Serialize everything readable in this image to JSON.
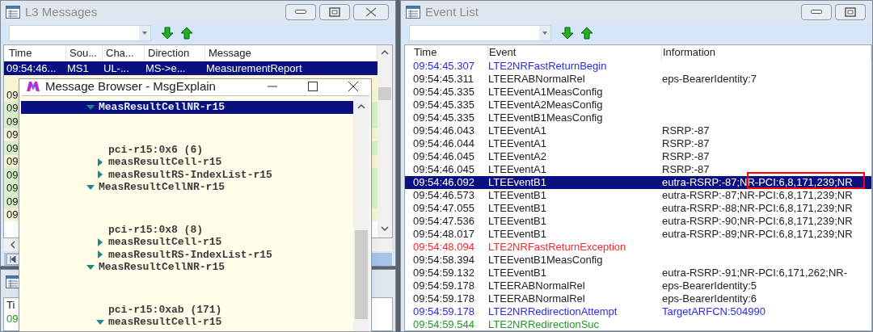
{
  "l3_messages": {
    "title": "L3 Messages",
    "columns": [
      "Time",
      "Sou...",
      "Cha...",
      "Direction",
      "Message"
    ],
    "rows": [
      {
        "cells": [
          "09:54:46...",
          "MS1",
          "UL-...",
          "MS->e...",
          "MeasurementReport"
        ],
        "selected": true
      },
      {
        "selected": false,
        "color": "#f7f5d4"
      },
      {
        "cells": [
          "09"
        ],
        "selected": false,
        "color": "#f7f5d4"
      },
      {
        "cells": [
          "09"
        ],
        "selected": false,
        "color": "#d9f0c9"
      },
      {
        "cells": [
          "09"
        ],
        "selected": false,
        "color": "#d9f0c9"
      },
      {
        "cells": [
          "09"
        ],
        "selected": false,
        "color": "#f7f5d4"
      },
      {
        "cells": [
          "09"
        ],
        "selected": false,
        "color": "#d9f0c9"
      },
      {
        "cells": [
          "09"
        ],
        "selected": false,
        "color": "#f7f5d4"
      },
      {
        "cells": [
          "09"
        ],
        "selected": false,
        "color": "#d9f0c9"
      },
      {
        "cells": [
          "09"
        ],
        "selected": false,
        "color": "#d9f0c9"
      },
      {
        "cells": [
          "09"
        ],
        "selected": false,
        "color": "#d9f0c9"
      },
      {
        "cells": [
          "09"
        ],
        "selected": false,
        "color": "#f7f5d4"
      }
    ]
  },
  "lower_window": {
    "columns": [
      "Ti"
    ],
    "rows": [
      {
        "cells": [
          "09"
        ],
        "color": "#229922"
      }
    ]
  },
  "message_browser": {
    "title": "Message Browser - MsgExplain",
    "tree": [
      {
        "label": "MeasResultCellNR-r15",
        "expanded": true,
        "selected": true,
        "children": [
          {
            "label": "pci-r15:0x6 (6)",
            "kind": "value"
          },
          {
            "label": "measResultCell-r15",
            "expanded": false,
            "selected": false
          },
          {
            "label": "measResultRS-IndexList-r15",
            "expanded": false,
            "selected": false
          }
        ]
      },
      {
        "label": "MeasResultCellNR-r15",
        "expanded": true,
        "selected": false,
        "children": [
          {
            "label": "pci-r15:0x8 (8)",
            "kind": "value"
          },
          {
            "label": "measResultCell-r15",
            "expanded": false,
            "selected": false
          },
          {
            "label": "measResultRS-IndexList-r15",
            "expanded": false,
            "selected": false
          }
        ]
      },
      {
        "label": "MeasResultCellNR-r15",
        "expanded": true,
        "selected": false,
        "children": [
          {
            "label": "pci-r15:0xab (171)",
            "kind": "value"
          },
          {
            "label": "measResultCell-r15",
            "expanded": true,
            "selected": false
          }
        ]
      }
    ]
  },
  "event_list": {
    "title": "Event List",
    "columns": [
      "Time",
      "Event",
      "Information"
    ],
    "rows": [
      {
        "time": "09:54:45.307",
        "event": "LTE2NRFastReturnBegin",
        "color": "#2a2ae6",
        "selected": false
      },
      {
        "time": "09:54:45.311",
        "event": "LTEERABNormalRel",
        "information": "eps-BearerIdentity:7",
        "color": "#202020",
        "selected": false
      },
      {
        "time": "09:54:45.335",
        "event": "LTEEventA1MeasConfig",
        "color": "#202020",
        "selected": false
      },
      {
        "time": "09:54:45.335",
        "event": "LTEEventA2MeasConfig",
        "color": "#202020",
        "selected": false
      },
      {
        "time": "09:54:45.335",
        "event": "LTEEventB1MeasConfig",
        "color": "#202020",
        "selected": false
      },
      {
        "time": "09:54:46.043",
        "event": "LTEEventA1",
        "information": "RSRP:-87",
        "color": "#202020",
        "selected": false
      },
      {
        "time": "09:54:46.044",
        "event": "LTEEventA1",
        "information": "RSRP:-87",
        "color": "#202020",
        "selected": false
      },
      {
        "time": "09:54:46.045",
        "event": "LTEEventA2",
        "information": "RSRP:-87",
        "color": "#202020",
        "selected": false
      },
      {
        "time": "09:54:46.045",
        "event": "LTEEventA1",
        "information": "RSRP:-87",
        "color": "#202020",
        "selected": false
      },
      {
        "time": "09:54:46.092",
        "event": "LTEEventB1",
        "information": "eutra-RSRP:-87;NR-PCI:6,8,171,239;NR",
        "selected": true,
        "annotated": true
      },
      {
        "time": "09:54:46.573",
        "event": "LTEEventB1",
        "information": "eutra-RSRP:-87;NR-PCI:6,8,171,239;NR",
        "color": "#202020",
        "selected": false
      },
      {
        "time": "09:54:47.055",
        "event": "LTEEventB1",
        "information": "eutra-RSRP:-88;NR-PCI:6,8,171,239;NR",
        "color": "#202020",
        "selected": false
      },
      {
        "time": "09:54:47.536",
        "event": "LTEEventB1",
        "information": "eutra-RSRP:-90;NR-PCI:6,8,171,239;NR",
        "color": "#202020",
        "selected": false
      },
      {
        "time": "09:54:48.017",
        "event": "LTEEventB1",
        "information": "eutra-RSRP:-89;NR-PCI:6,8,171,239;NR",
        "color": "#202020",
        "selected": false
      },
      {
        "time": "09:54:48.094",
        "event": "LTE2NRFastReturnException",
        "color": "#f52a2a",
        "selected": false
      },
      {
        "time": "09:54:58.394",
        "event": "LTEEventB1MeasConfig",
        "color": "#202020",
        "selected": false
      },
      {
        "time": "09:54:59.132",
        "event": "LTEEventB1",
        "information": "eutra-RSRP:-91;NR-PCI:6,171,262;NR-",
        "color": "#202020",
        "selected": false
      },
      {
        "time": "09:54:59.178",
        "event": "LTEERABNormalRel",
        "information": "eps-BearerIdentity:5",
        "color": "#202020",
        "selected": false
      },
      {
        "time": "09:54:59.178",
        "event": "LTEERABNormalRel",
        "information": "eps-BearerIdentity:6",
        "color": "#202020",
        "selected": false
      },
      {
        "time": "09:54:59.178",
        "event": "LTE2NRRedirectionAttempt",
        "information": "TargetARFCN:504990",
        "color": "#2a2ae6",
        "selected": false
      },
      {
        "time": "09:54:59.544",
        "event": "LTE2NRRedirectionSuc",
        "color": "#229922",
        "selected": false
      }
    ]
  }
}
